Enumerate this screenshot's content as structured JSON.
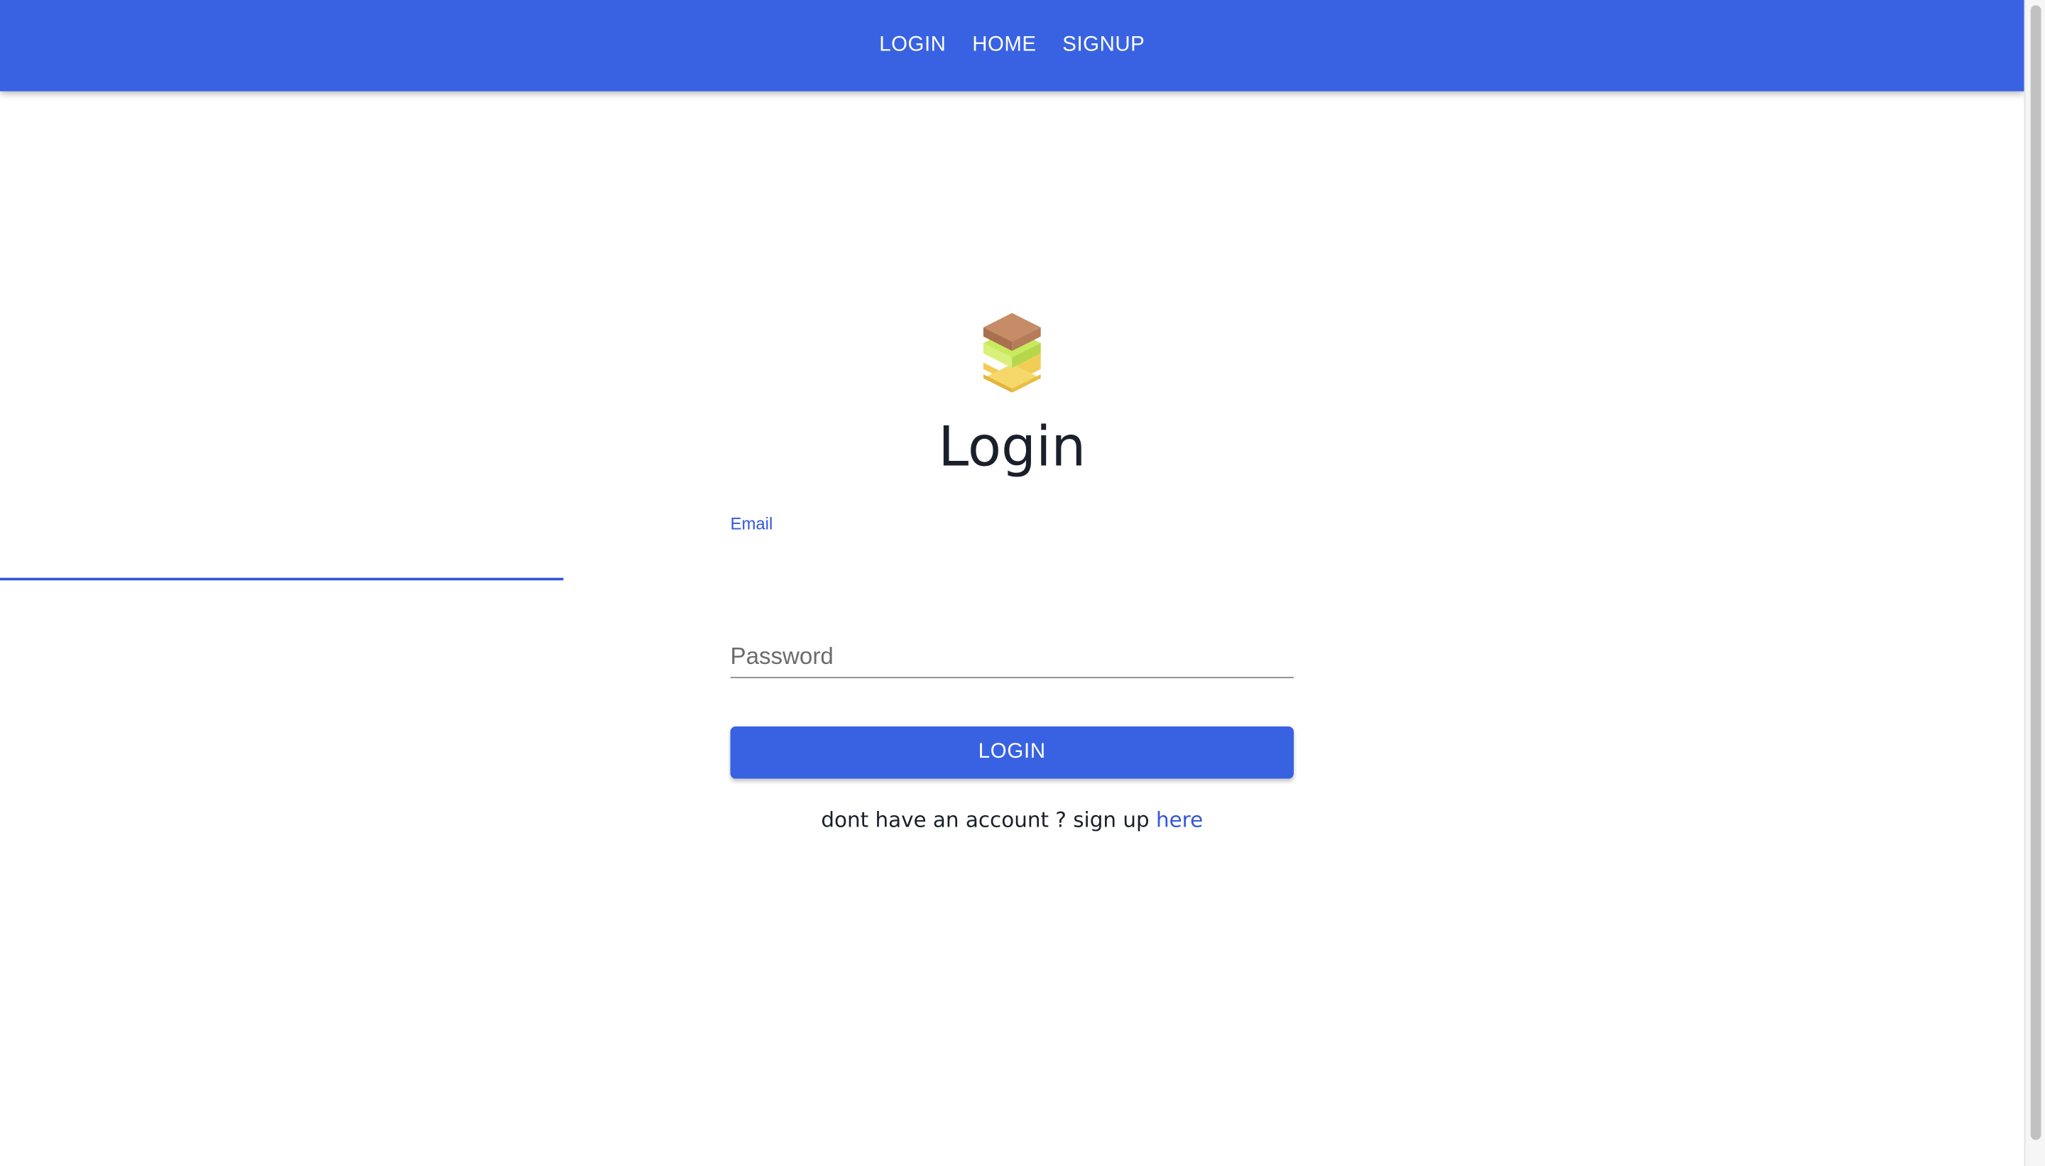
{
  "nav": {
    "items": [
      {
        "label": "LOGIN"
      },
      {
        "label": "HOME"
      },
      {
        "label": "SIGNUP"
      }
    ]
  },
  "form": {
    "title": "Login",
    "email": {
      "label": "Email",
      "value": ""
    },
    "password": {
      "placeholder": "Password",
      "value": ""
    },
    "submit_label": "LOGIN",
    "signup_prompt": "dont have an account ? sign up",
    "signup_link": "here"
  },
  "colors": {
    "primary": "#3862e2",
    "focus": "#3357d8",
    "heading_text": "#1b1f2a",
    "logo_top": "#b9805e",
    "logo_middle": "#c8ea5e",
    "logo_bottom": "#f2cd56"
  },
  "icons": {
    "logo": "stacked-bricks-s-logo"
  }
}
